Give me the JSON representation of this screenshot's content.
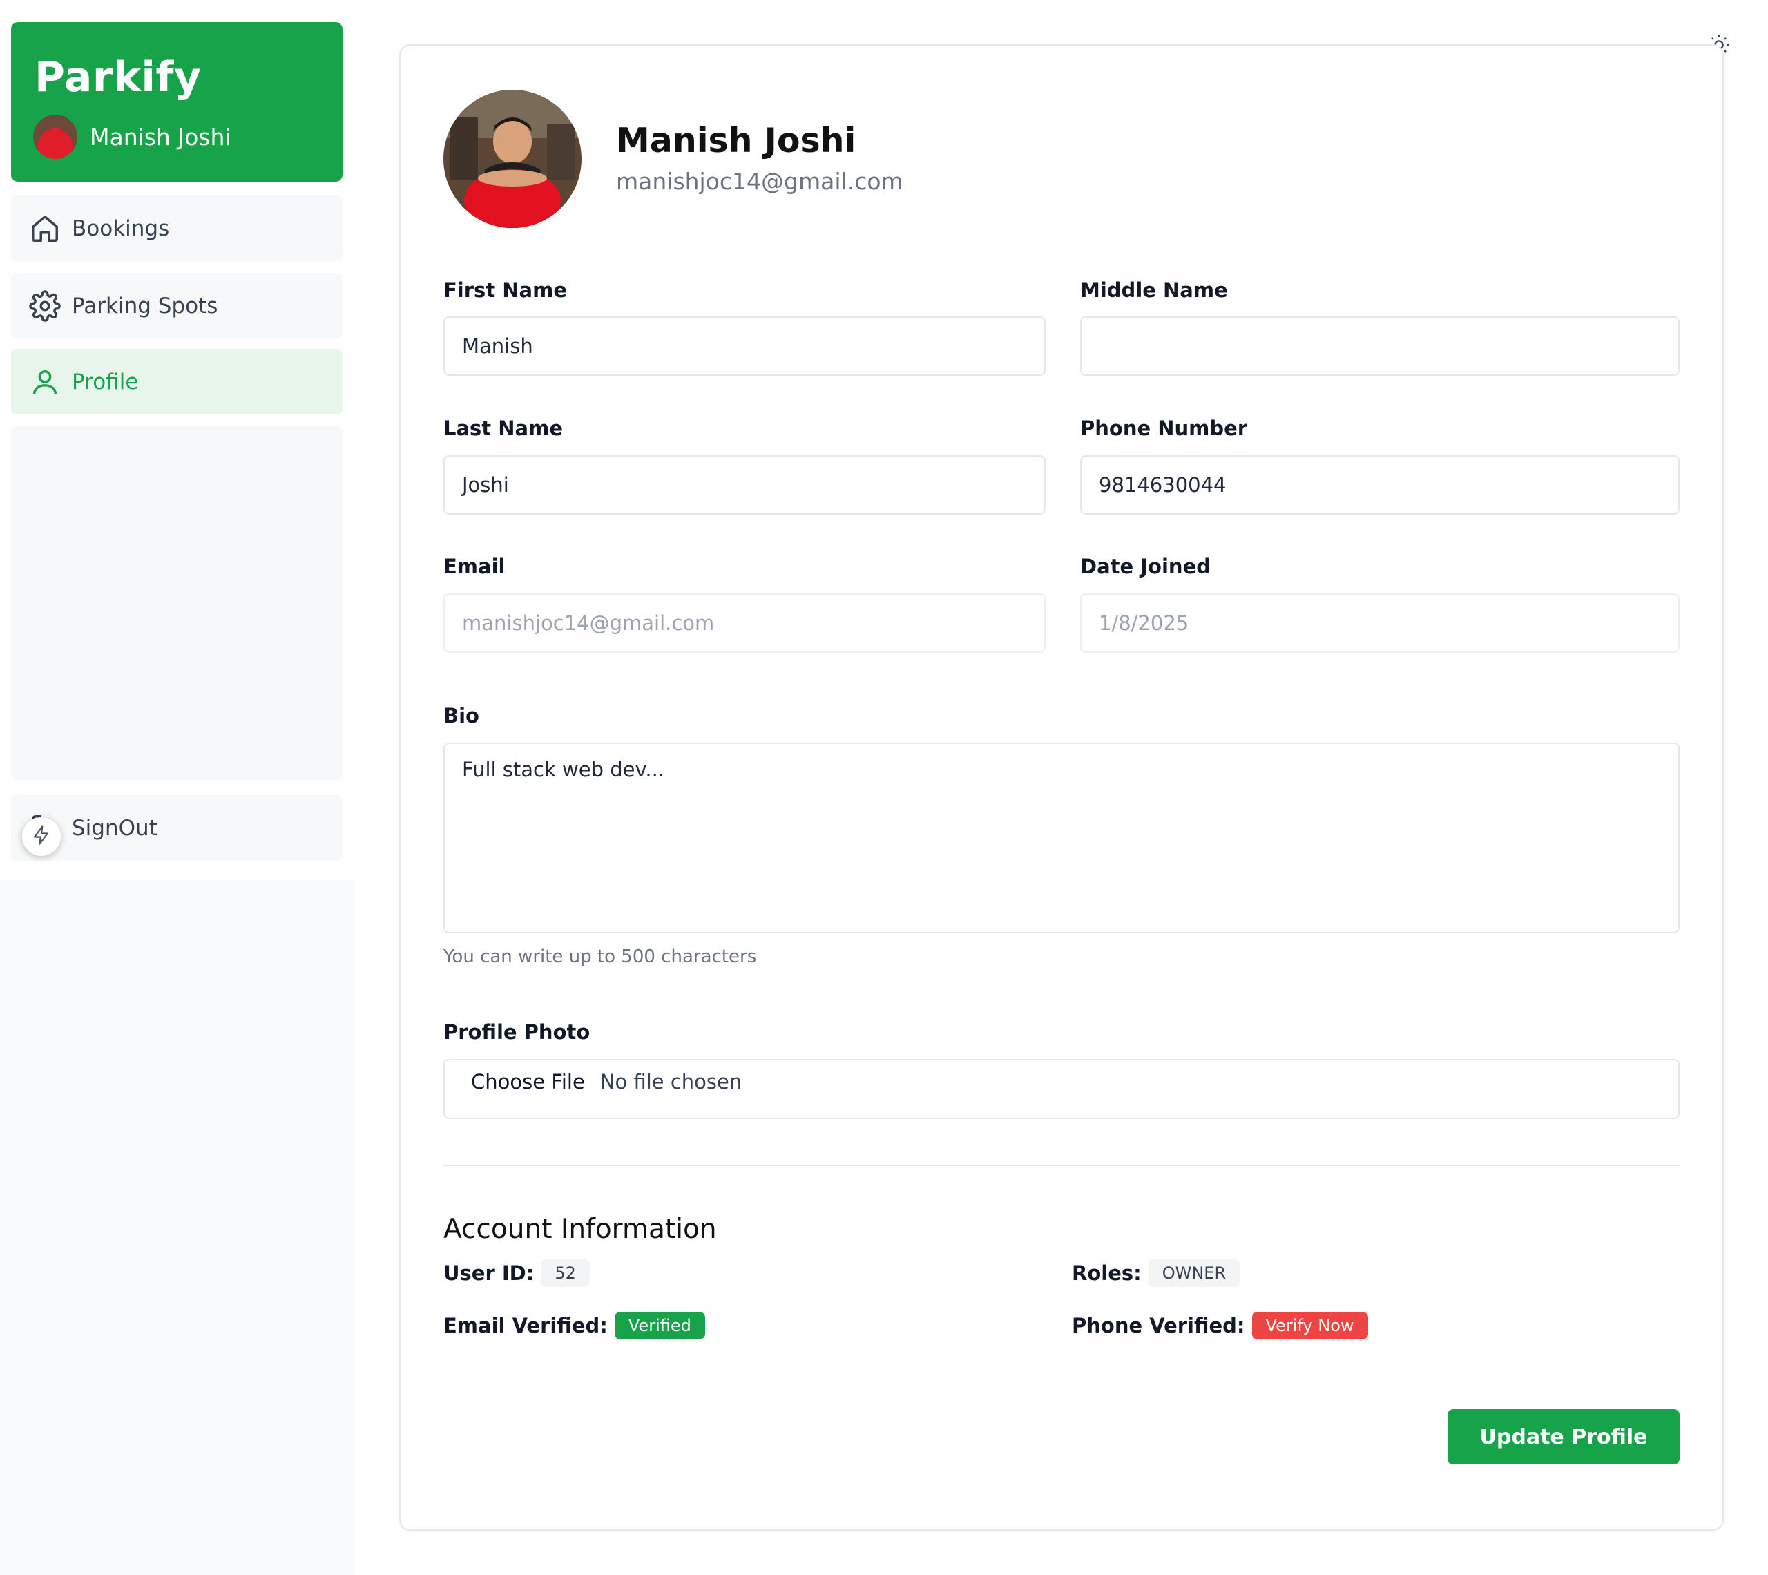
{
  "brand": {
    "title": "Parkify",
    "user_name": "Manish Joshi"
  },
  "sidebar": {
    "items": [
      {
        "label": "Bookings",
        "icon": "home-icon"
      },
      {
        "label": "Parking Spots",
        "icon": "gear-icon"
      },
      {
        "label": "Profile",
        "icon": "user-icon",
        "active": true
      }
    ],
    "signout_label": "SignOut"
  },
  "header": {
    "name": "Manish Joshi",
    "email": "manishjoc14@gmail.com"
  },
  "form": {
    "first_name": {
      "label": "First Name",
      "value": "Manish"
    },
    "middle_name": {
      "label": "Middle Name",
      "value": ""
    },
    "last_name": {
      "label": "Last Name",
      "value": "Joshi"
    },
    "phone": {
      "label": "Phone Number",
      "value": "9814630044"
    },
    "email": {
      "label": "Email",
      "value": "manishjoc14@gmail.com"
    },
    "date_joined": {
      "label": "Date Joined",
      "value": "1/8/2025"
    },
    "bio": {
      "label": "Bio",
      "value": "Full stack web dev...",
      "hint": "You can write up to 500 characters"
    },
    "photo": {
      "label": "Profile Photo",
      "button": "Choose File",
      "status": "No file chosen"
    }
  },
  "account": {
    "title": "Account Information",
    "user_id_label": "User ID:",
    "user_id": "52",
    "roles_label": "Roles:",
    "roles": "OWNER",
    "email_verified_label": "Email Verified:",
    "email_verified": "Verified",
    "phone_verified_label": "Phone Verified:",
    "phone_verified": "Verify Now"
  },
  "update_button": "Update Profile",
  "colors": {
    "brand": "#16a34a",
    "danger": "#ef4444",
    "active_bg": "#e8f5eb"
  }
}
